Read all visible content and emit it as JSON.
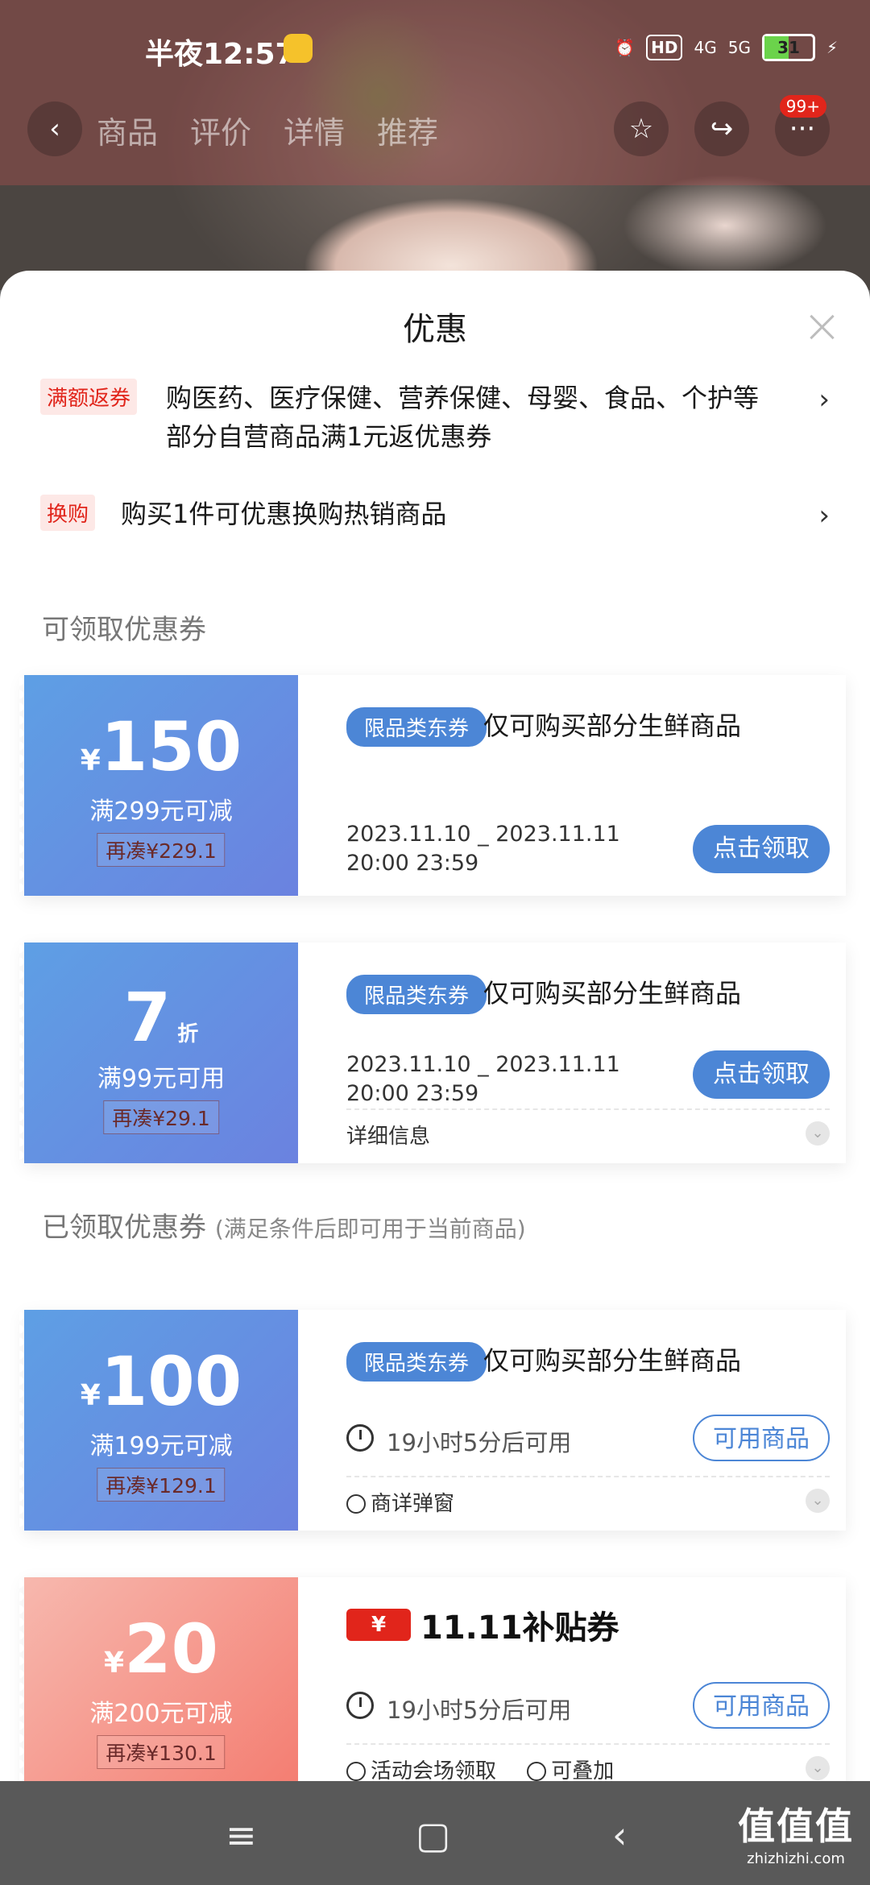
{
  "status_bar": {
    "time": "半夜12:57",
    "network": "HD",
    "signal_4g": "4G",
    "signal_5g": "5G",
    "battery": "31"
  },
  "header": {
    "tabs": [
      "商品",
      "评价",
      "详情",
      "推荐"
    ],
    "badge": "99+"
  },
  "sheet": {
    "title": "优惠",
    "promos": [
      {
        "tag": "满额返券",
        "text": "购医药、医疗保健、营养保健、母婴、食品、个护等部分自营商品满1元返优惠券"
      },
      {
        "tag": "换购",
        "text": "购买1件可优惠换购热销商品"
      }
    ],
    "section_available": "可领取优惠券",
    "section_owned": "已领取优惠券",
    "section_owned_sub": "(满足条件后即可用于当前商品)",
    "available_coupons": [
      {
        "currency": "¥",
        "amount": "150",
        "condition": "满299元可减",
        "need": "再凑¥229.1",
        "tag": "限品类东券",
        "scope": "仅可购买部分生鲜商品",
        "date_line1": "2023.11.10 _ 2023.11.11",
        "date_line2": "20:00 23:59",
        "button": "点击领取"
      },
      {
        "amount": "7",
        "unit": "折",
        "condition": "满99元可用",
        "need": "再凑¥29.1",
        "tag": "限品类东券",
        "scope": "仅可购买部分生鲜商品",
        "date_line1": "2023.11.10 _ 2023.11.11",
        "date_line2": "20:00 23:59",
        "button": "点击领取",
        "detail": "详细信息"
      }
    ],
    "owned_coupons": [
      {
        "currency": "¥",
        "amount": "100",
        "condition": "满199元可减",
        "need": "再凑¥129.1",
        "tag": "限品类东券",
        "scope": "仅可购买部分生鲜商品",
        "wait": "19小时5分后可用",
        "button": "可用商品",
        "source": "商详弹窗"
      },
      {
        "currency": "¥",
        "amount": "20",
        "condition": "满200元可减",
        "need": "再凑¥130.1",
        "logo_yen": "¥",
        "logo_text": "11.11补贴券",
        "wait": "19小时5分后可用",
        "button": "可用商品",
        "source": "活动会场领取",
        "stack": "可叠加"
      }
    ]
  },
  "bottom_nav": {
    "watermark": "值值值",
    "watermark_url": "zhizhizhi.com"
  }
}
